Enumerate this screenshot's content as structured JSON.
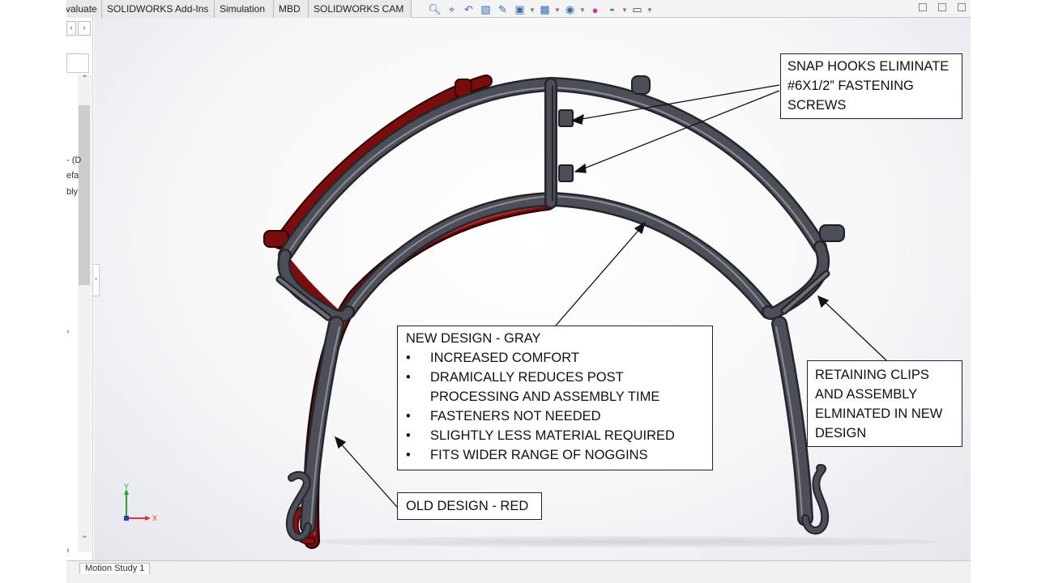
{
  "ribbon": {
    "tabs": [
      "valuate",
      "SOLIDWORKS Add-Ins",
      "Simulation",
      "MBD",
      "SOLIDWORKS CAM"
    ]
  },
  "hud_toolbar": {
    "icons": [
      "zoom-to-fit-icon",
      "zoom-to-area-icon",
      "previous-view-icon",
      "section-view-icon",
      "dynamic-annotation-icon",
      "view-orientation-icon",
      "display-style-icon",
      "hide-show-icon",
      "edit-appearance-icon",
      "apply-scene-icon",
      "view-settings-icon"
    ]
  },
  "feature_tree": {
    "fragments": [
      "- (D",
      "efa",
      "bly"
    ]
  },
  "bottom_tabs": [
    "Motion Study 1"
  ],
  "callouts": {
    "snap_hooks": {
      "lines": [
        "SNAP HOOKS ELIMINATE",
        "#6X1/2” FASTENING",
        "SCREWS"
      ]
    },
    "new_design": {
      "title": "NEW DESIGN - GRAY",
      "bullets": [
        "INCREASED COMFORT",
        "DRAMICALLY REDUCES POST PROCESSING AND ASSEMBLY TIME",
        "FASTENERS NOT NEEDED",
        "SLIGHTLY LESS MATERIAL REQUIRED",
        "FITS WIDER RANGE OF NOGGINS"
      ]
    },
    "retaining_clips": {
      "lines": [
        "RETAINING CLIPS",
        "AND ASSEMBLY",
        "ELMINATED IN NEW",
        "DESIGN"
      ]
    },
    "old_design": {
      "title": "OLD DESIGN - RED"
    }
  },
  "triad": {
    "y_label": "Y",
    "x_label": "X"
  },
  "colors": {
    "new_design": "#4a4c55",
    "old_design": "#7a0c0c"
  }
}
